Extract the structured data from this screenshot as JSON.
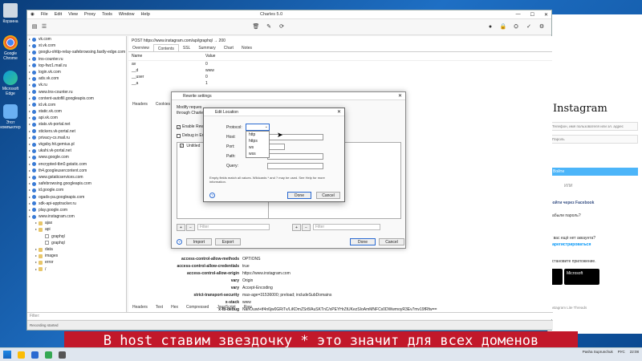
{
  "desktop": {
    "icons": [
      "Корзина",
      "Google Chrome",
      "Microsoft Edge",
      "Этот компьютер"
    ]
  },
  "charles": {
    "title": "Charles 5.0",
    "menu": [
      "File",
      "Edit",
      "View",
      "Proxy",
      "Tools",
      "Window",
      "Help"
    ],
    "tree": [
      {
        "label": "vk.com",
        "indent": 0,
        "kind": "host"
      },
      {
        "label": "st.vk.com",
        "indent": 0,
        "kind": "host"
      },
      {
        "label": "googlu-ohttp-relay-safebrowsing.fastly-edge.com",
        "indent": 0,
        "kind": "host"
      },
      {
        "label": "tns-counter.ru",
        "indent": 0,
        "kind": "host"
      },
      {
        "label": "top-fwz1.mail.ru",
        "indent": 0,
        "kind": "host"
      },
      {
        "label": "login.vk.com",
        "indent": 0,
        "kind": "host"
      },
      {
        "label": "ads.vk.com",
        "indent": 0,
        "kind": "host"
      },
      {
        "label": "vk.ru",
        "indent": 0,
        "kind": "host"
      },
      {
        "label": "www.tns-counter.ru",
        "indent": 0,
        "kind": "host"
      },
      {
        "label": "content-autofill.googleapis.com",
        "indent": 0,
        "kind": "host"
      },
      {
        "label": "id.vk.com",
        "indent": 0,
        "kind": "host"
      },
      {
        "label": "static.vk.com",
        "indent": 0,
        "kind": "host"
      },
      {
        "label": "api.vk.com",
        "indent": 0,
        "kind": "host"
      },
      {
        "label": "stats.vk-portal.net",
        "indent": 0,
        "kind": "host"
      },
      {
        "label": "stickers.vk-portal.net",
        "indent": 0,
        "kind": "host"
      },
      {
        "label": "privacy-cs.mail.ru",
        "indent": 0,
        "kind": "host"
      },
      {
        "label": "vkgsby.hit.gemius.pl",
        "indent": 0,
        "kind": "host"
      },
      {
        "label": "ukahi.vk-portal.net",
        "indent": 0,
        "kind": "host"
      },
      {
        "label": "www.google.com",
        "indent": 0,
        "kind": "host"
      },
      {
        "label": "encrypted-tbn0.gstatic.com",
        "indent": 0,
        "kind": "host"
      },
      {
        "label": "th4.googleusercontent.com",
        "indent": 0,
        "kind": "host"
      },
      {
        "label": "www.gstaticservices.com",
        "indent": 0,
        "kind": "host"
      },
      {
        "label": "safebrowsing.googleapis.com",
        "indent": 0,
        "kind": "host"
      },
      {
        "label": "id.google.com",
        "indent": 0,
        "kind": "host"
      },
      {
        "label": "ogads-pa.googleapis.com",
        "indent": 0,
        "kind": "host"
      },
      {
        "label": "sdk-api-apptracker.ru",
        "indent": 0,
        "kind": "host"
      },
      {
        "label": "play.google.com",
        "indent": 0,
        "kind": "host"
      },
      {
        "label": "www.instagram.com",
        "indent": 0,
        "kind": "host"
      },
      {
        "label": "ajax",
        "indent": 1,
        "kind": "folder"
      },
      {
        "label": "api",
        "indent": 1,
        "kind": "folder"
      },
      {
        "label": "graphql",
        "indent": 2,
        "kind": "file"
      },
      {
        "label": "graphql",
        "indent": 2,
        "kind": "file"
      },
      {
        "label": "data",
        "indent": 1,
        "kind": "folder"
      },
      {
        "label": "images",
        "indent": 1,
        "kind": "folder"
      },
      {
        "label": "error",
        "indent": 1,
        "kind": "folder"
      },
      {
        "label": "/",
        "indent": 1,
        "kind": "folder"
      }
    ],
    "filter_label": "Filter:",
    "status": "Recording started",
    "request_line": "POST https://www.instagram.com/api/graphql  → 200",
    "top_tabs": [
      "Overview",
      "Contents",
      "SSL",
      "Summary",
      "Chart",
      "Notes"
    ],
    "nv_header": {
      "name": "Name",
      "value": "Value"
    },
    "nv_rows": [
      {
        "name": "av",
        "value": "0"
      },
      {
        "name": "__d",
        "value": "www"
      },
      {
        "name": "__user",
        "value": "0"
      },
      {
        "name": "__a",
        "value": "1"
      }
    ],
    "mid_tabs": [
      "Headers",
      "Cookies"
    ],
    "headers": [
      {
        "k": "access-control-allow-methods",
        "v": "OPTIONS"
      },
      {
        "k": "access-control-allow-credentials",
        "v": "true"
      },
      {
        "k": "access-control-allow-origin",
        "v": "https://www.instagram.com"
      },
      {
        "k": "vary",
        "v": "Origin"
      },
      {
        "k": "vary",
        "v": "Accept-Encoding"
      },
      {
        "k": "strict-transport-security",
        "v": "max-age=31536000; preload; includeSubDomains"
      },
      {
        "k": "x-stack",
        "v": "www"
      },
      {
        "k": "x-fb-debug",
        "v": "NanOuwt+tf4n6jw0GRiTv/LiKDmZSr8/AuSKTnC/xPEYHrZtUKezSIoAmMNFCs0DWwmoyR3Ev7mv19fRfw=="
      }
    ],
    "bottom_tabs": [
      "Headers",
      "Text",
      "Hex",
      "Compressed",
      "JavaScript",
      "Raw"
    ]
  },
  "rewrite": {
    "title": "Rewrite settings",
    "desc_line1": "Modify reques",
    "desc_line2": "through Charle",
    "enable_label": "Enable Rew",
    "debug_label": "Debug in Er",
    "list_item": "Untitled",
    "filter_placeholder": "Filter",
    "import_label": "Import",
    "export_label": "Export",
    "done_label": "Done",
    "cancel_label": "Cancel",
    "add_symbol": "+",
    "remove_symbol": "−"
  },
  "editloc": {
    "title": "Edit Location",
    "protocol_label": "Protocol:",
    "host_label": "Host:",
    "port_label": "Port:",
    "path_label": "Path:",
    "query_label": "Query:",
    "options": [
      "http",
      "https",
      "ws",
      "wss"
    ],
    "help_text": "Empty fields match all values. Wildcards * and ? may be used. See Help for more information.",
    "done_label": "Done",
    "cancel_label": "Cancel",
    "help_symbol": "?"
  },
  "browser": {
    "logo": "Instagram",
    "input1_placeholder": "Телефон, имя пользователя или эл. адрес",
    "input2_placeholder": "Пароль",
    "login_button": "Войти",
    "or_text": "ИЛИ",
    "fb_login": "Войти через Facebook",
    "forgot": "Забыли пароль?",
    "no_account": "У вас ещё нет аккаунта?",
    "register": "Зарегистрироваться",
    "get_app": "Установите приложение.",
    "store1": "Google Play",
    "store2": "Microsoft",
    "footer": "Instagram Lite   Threads"
  },
  "subtitle": "В host ставим звездочку * это значит для всех доменов",
  "taskbar": {
    "user": "Pasha Suprunchuk",
    "lang": "РУС",
    "time": "22:08"
  }
}
